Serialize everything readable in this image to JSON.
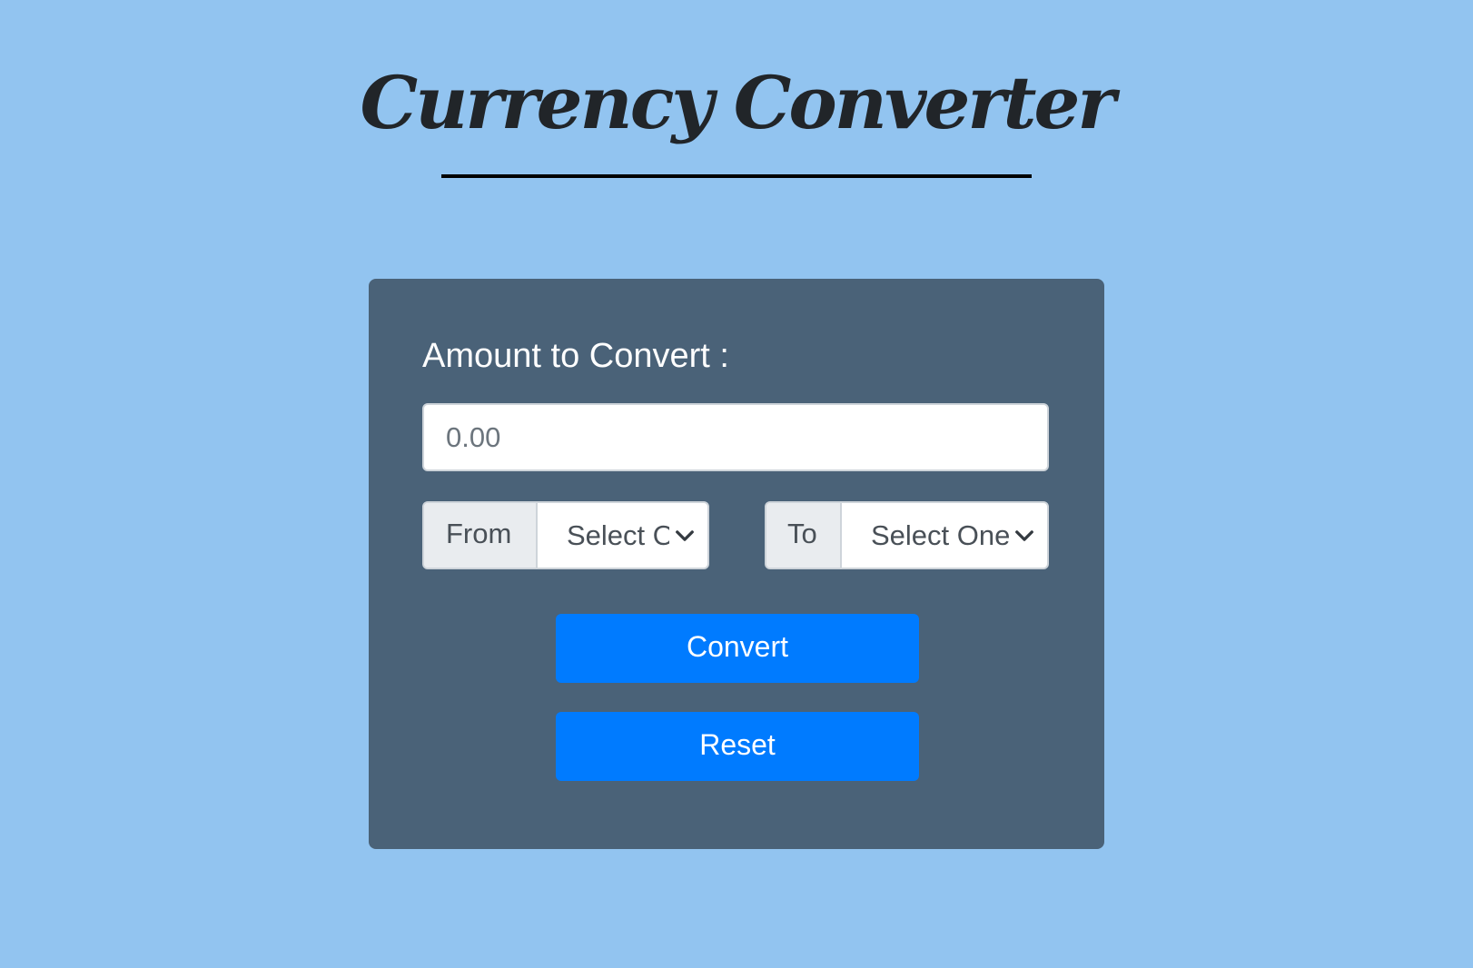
{
  "header": {
    "title": "Currency Converter"
  },
  "form": {
    "amount_label": "Amount to Convert :",
    "amount_placeholder": "0.00",
    "amount_value": "",
    "from": {
      "label": "From",
      "selected": "Select One"
    },
    "to": {
      "label": "To",
      "selected": "Select One"
    },
    "convert_label": "Convert",
    "reset_label": "Reset"
  },
  "colors": {
    "page_background": "#92c4f0",
    "card_background": "#4a6278",
    "button_primary": "#007bff"
  },
  "icons": {
    "select_arrow": "chevron-down-icon"
  }
}
